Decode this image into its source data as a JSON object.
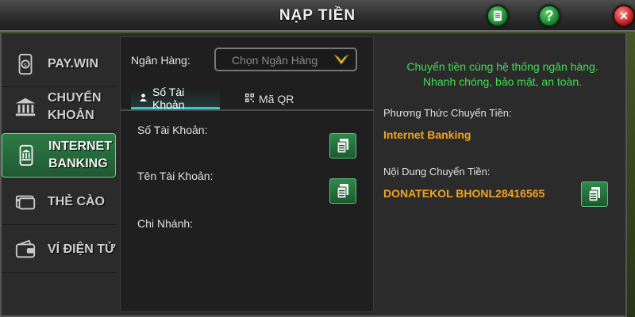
{
  "header": {
    "title": "NẠP TIỀN"
  },
  "sidebar": {
    "items": [
      {
        "label_line1": "PAY.WIN",
        "label_line2": "",
        "icon": "phone-coin-icon"
      },
      {
        "label_line1": "CHUYỂN",
        "label_line2": "KHOẢN",
        "icon": "bank-icon"
      },
      {
        "label_line1": "INTERNET",
        "label_line2": "BANKING",
        "icon": "mobile-bank-icon"
      },
      {
        "label_line1": "THẺ CÀO",
        "label_line2": "",
        "icon": "card-icon"
      },
      {
        "label_line1": "VÍ ĐIỆN TỬ",
        "label_line2": "",
        "icon": "wallet-icon"
      }
    ],
    "active_index": 2
  },
  "form": {
    "bank_label": "Ngân Hàng:",
    "bank_placeholder": "Chọn Ngân Hàng",
    "tabs": [
      {
        "label": "Số Tài Khoản"
      },
      {
        "label": "Mã QR"
      }
    ],
    "fields": [
      {
        "label": "Số Tài Khoản:"
      },
      {
        "label": "Tên Tài Khoản:"
      },
      {
        "label": "Chi Nhánh:"
      }
    ]
  },
  "info": {
    "line1": "Chuyển tiền cùng hệ thống ngân hàng.",
    "line2": "Nhanh chóng, bảo mật, an toàn.",
    "method_label": "Phương Thức Chuyển Tiền:",
    "method_value": "Internet Banking",
    "content_label": "Nội Dung Chuyển Tiền:",
    "content_value": "DONATEKOL BHONL28416565"
  },
  "colors": {
    "accent_green": "#3fe04f",
    "value_orange": "#f3a323",
    "tab_accent": "#3fc5c8"
  }
}
